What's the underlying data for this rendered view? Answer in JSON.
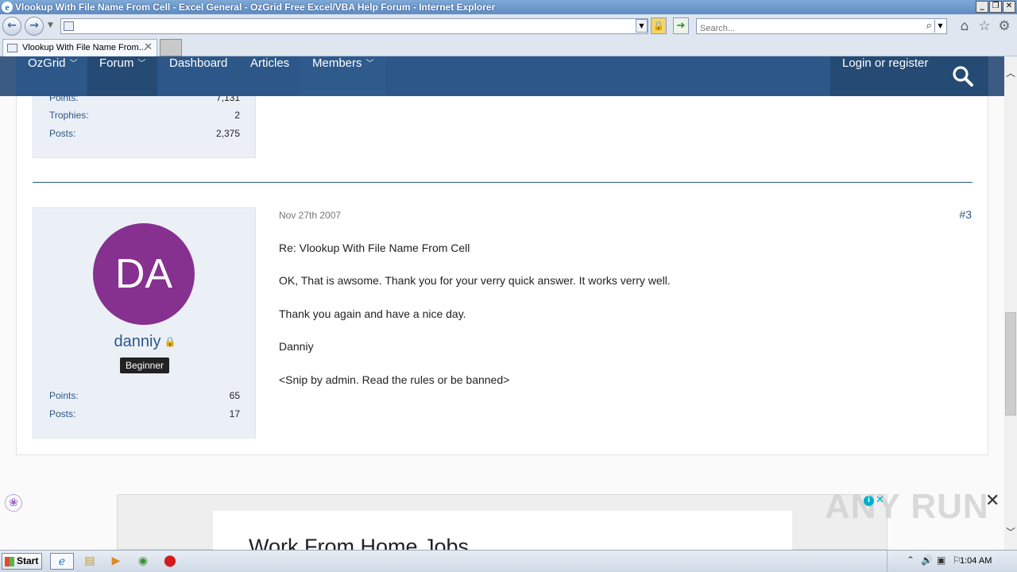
{
  "window": {
    "title": "Vlookup With File Name From Cell - Excel General - OzGrid Free Excel/VBA Help Forum - Internet Explorer",
    "buttons": [
      "_",
      "❐",
      "✕"
    ]
  },
  "addressbar": {
    "url": "",
    "search_placeholder": "Search..."
  },
  "tabs": [
    {
      "label": "Vlookup With File Name From..."
    }
  ],
  "nav": {
    "items": [
      {
        "label": "OzGrid",
        "dropdown": true
      },
      {
        "label": "Forum",
        "dropdown": true,
        "active": true
      },
      {
        "label": "Dashboard",
        "dropdown": false
      },
      {
        "label": "Articles",
        "dropdown": false
      },
      {
        "label": "Members",
        "dropdown": true
      }
    ],
    "login_label": "Login or register",
    "search_icon": "search-icon"
  },
  "prev_user": {
    "stats": [
      {
        "label": "Points:",
        "value": "7,131"
      },
      {
        "label": "Trophies:",
        "value": "2"
      },
      {
        "label": "Posts:",
        "value": "2,375"
      }
    ]
  },
  "post": {
    "avatar_initials": "DA",
    "avatar_color": "#86308f",
    "username": "danniy",
    "rank": "Beginner",
    "stats": [
      {
        "label": "Points:",
        "value": "65"
      },
      {
        "label": "Posts:",
        "value": "17"
      }
    ],
    "date": "Nov 27th 2007",
    "number": "#3",
    "lines": [
      "Re: Vlookup With File Name From Cell",
      "OK, That is awsome. Thank you for your verry quick answer. It works verry well.",
      "Thank you again and have a nice day.",
      "Danniy",
      "<Snip by admin. Read the rules or be banned>"
    ]
  },
  "ad": {
    "title": "Work From Home Jobs",
    "watermark": "ANY RUN"
  },
  "taskbar": {
    "start_label": "Start",
    "clock": "1:04 AM"
  },
  "colors": {
    "nav_bg": "#2c5788",
    "nav_active": "#254a74",
    "link": "#2c5788",
    "user_panel": "#ebf0f7"
  }
}
